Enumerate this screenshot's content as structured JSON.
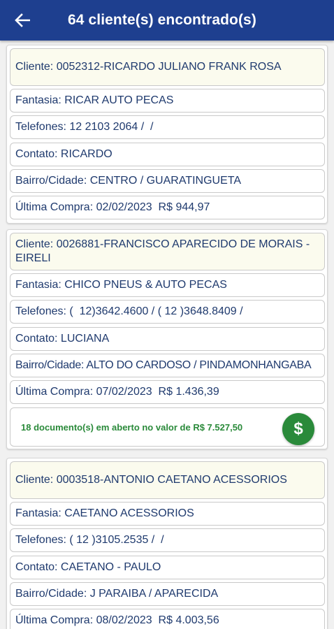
{
  "header": {
    "title": "64 cliente(s) encontrado(s)",
    "back_icon": "arrow-left-icon"
  },
  "colors": {
    "appbar": "#1e3f8f",
    "text": "#1f3a6e",
    "client_bg": "#fbfbee",
    "open_docs": "#2a8a3a"
  },
  "clients": [
    {
      "cliente": "Cliente: 0052312-RICARDO JULIANO FRANK ROSA",
      "fantasia": "Fantasia: RICAR AUTO PECAS",
      "telefones": "Telefones: 12 2103 2064 /  /",
      "contato": "Contato: RICARDO",
      "bairro_cidade": "Bairro/Cidade: CENTRO / GUARATINGUETA",
      "ultima_compra": "Última Compra: 02/02/2023  R$ 944,97"
    },
    {
      "cliente": "Cliente: 0026881-FRANCISCO APARECIDO DE MORAIS - EIRELI",
      "fantasia": "Fantasia: CHICO PNEUS & AUTO PECAS",
      "telefones": "Telefones: (  12)3642.4600 / ( 12 )3648.8409 /",
      "contato": "Contato: LUCIANA",
      "bairro_cidade": "Bairro/Cidade: ALTO DO CARDOSO / PINDAMONHANGABA",
      "ultima_compra": "Última Compra: 07/02/2023  R$ 1.436,39",
      "documentos": "18 documento(s) em aberto no valor de R$ 7.527,50",
      "pay_icon": "dollar-icon"
    },
    {
      "cliente": "Cliente: 0003518-ANTONIO CAETANO ACESSORIOS",
      "fantasia": "Fantasia: CAETANO ACESSORIOS",
      "telefones": "Telefones: ( 12 )3105.2535 /  /",
      "contato": "Contato: CAETANO - PAULO",
      "bairro_cidade": "Bairro/Cidade: J PARAIBA / APARECIDA",
      "ultima_compra": "Última Compra: 08/02/2023  R$ 4.003,56"
    }
  ]
}
